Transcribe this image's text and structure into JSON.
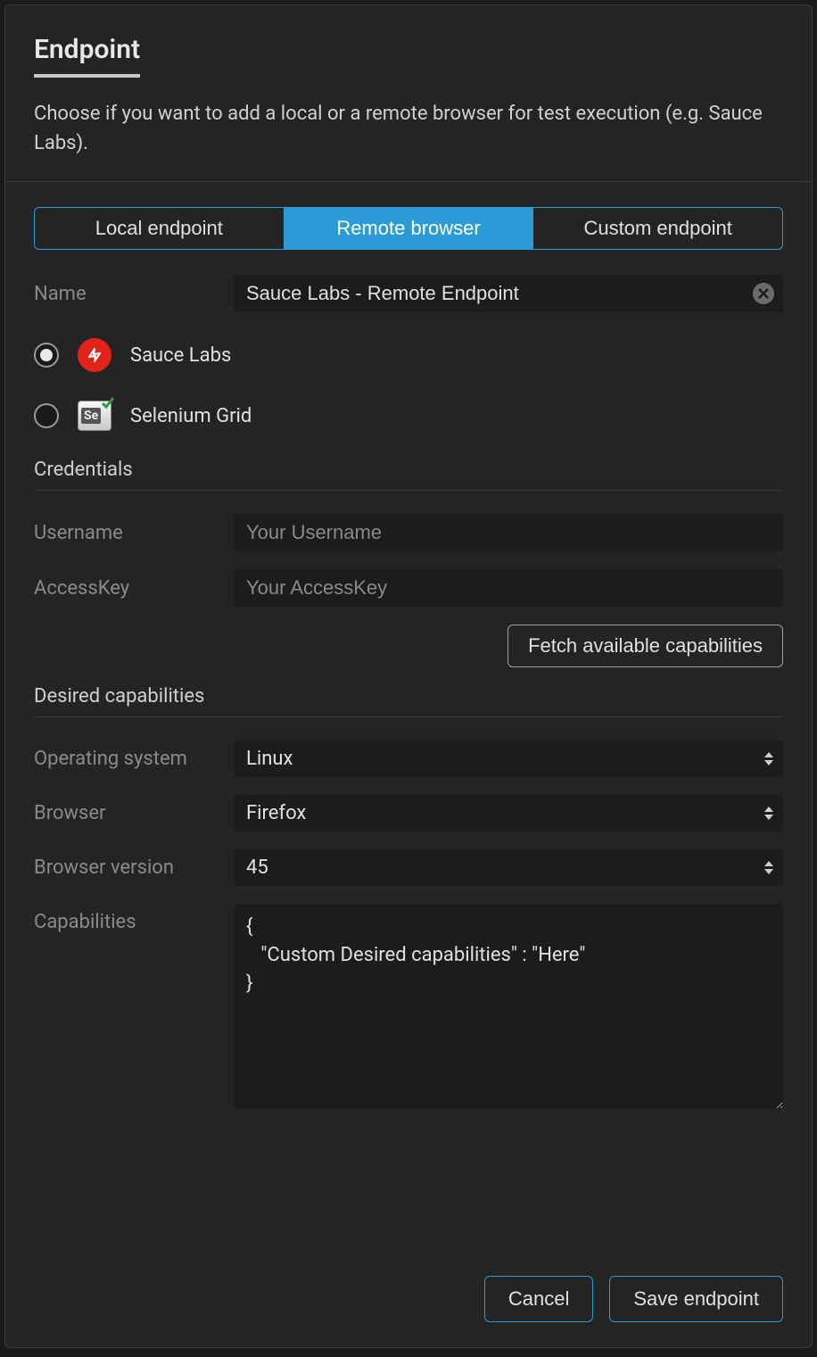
{
  "header": {
    "title": "Endpoint",
    "subtitle": "Choose if you want to add a local or a remote browser for test execution (e.g. Sauce Labs)."
  },
  "tabs": {
    "local": "Local endpoint",
    "remote": "Remote browser",
    "custom": "Custom endpoint"
  },
  "name": {
    "label": "Name",
    "value": "Sauce Labs - Remote Endpoint"
  },
  "providers": {
    "sauce": "Sauce Labs",
    "selenium": "Selenium Grid"
  },
  "credentials": {
    "section": "Credentials",
    "username_label": "Username",
    "username_placeholder": "Your Username",
    "accesskey_label": "AccessKey",
    "accesskey_placeholder": "Your AccessKey",
    "fetch": "Fetch available capabilities"
  },
  "capabilities": {
    "section": "Desired capabilities",
    "os_label": "Operating system",
    "os_value": "Linux",
    "browser_label": "Browser",
    "browser_value": "Firefox",
    "version_label": "Browser version",
    "version_value": "45",
    "capabilities_label": "Capabilities",
    "capabilities_value": "{\n   \"Custom Desired capabilities\" : \"Here\"\n}"
  },
  "footer": {
    "cancel": "Cancel",
    "save": "Save endpoint"
  }
}
